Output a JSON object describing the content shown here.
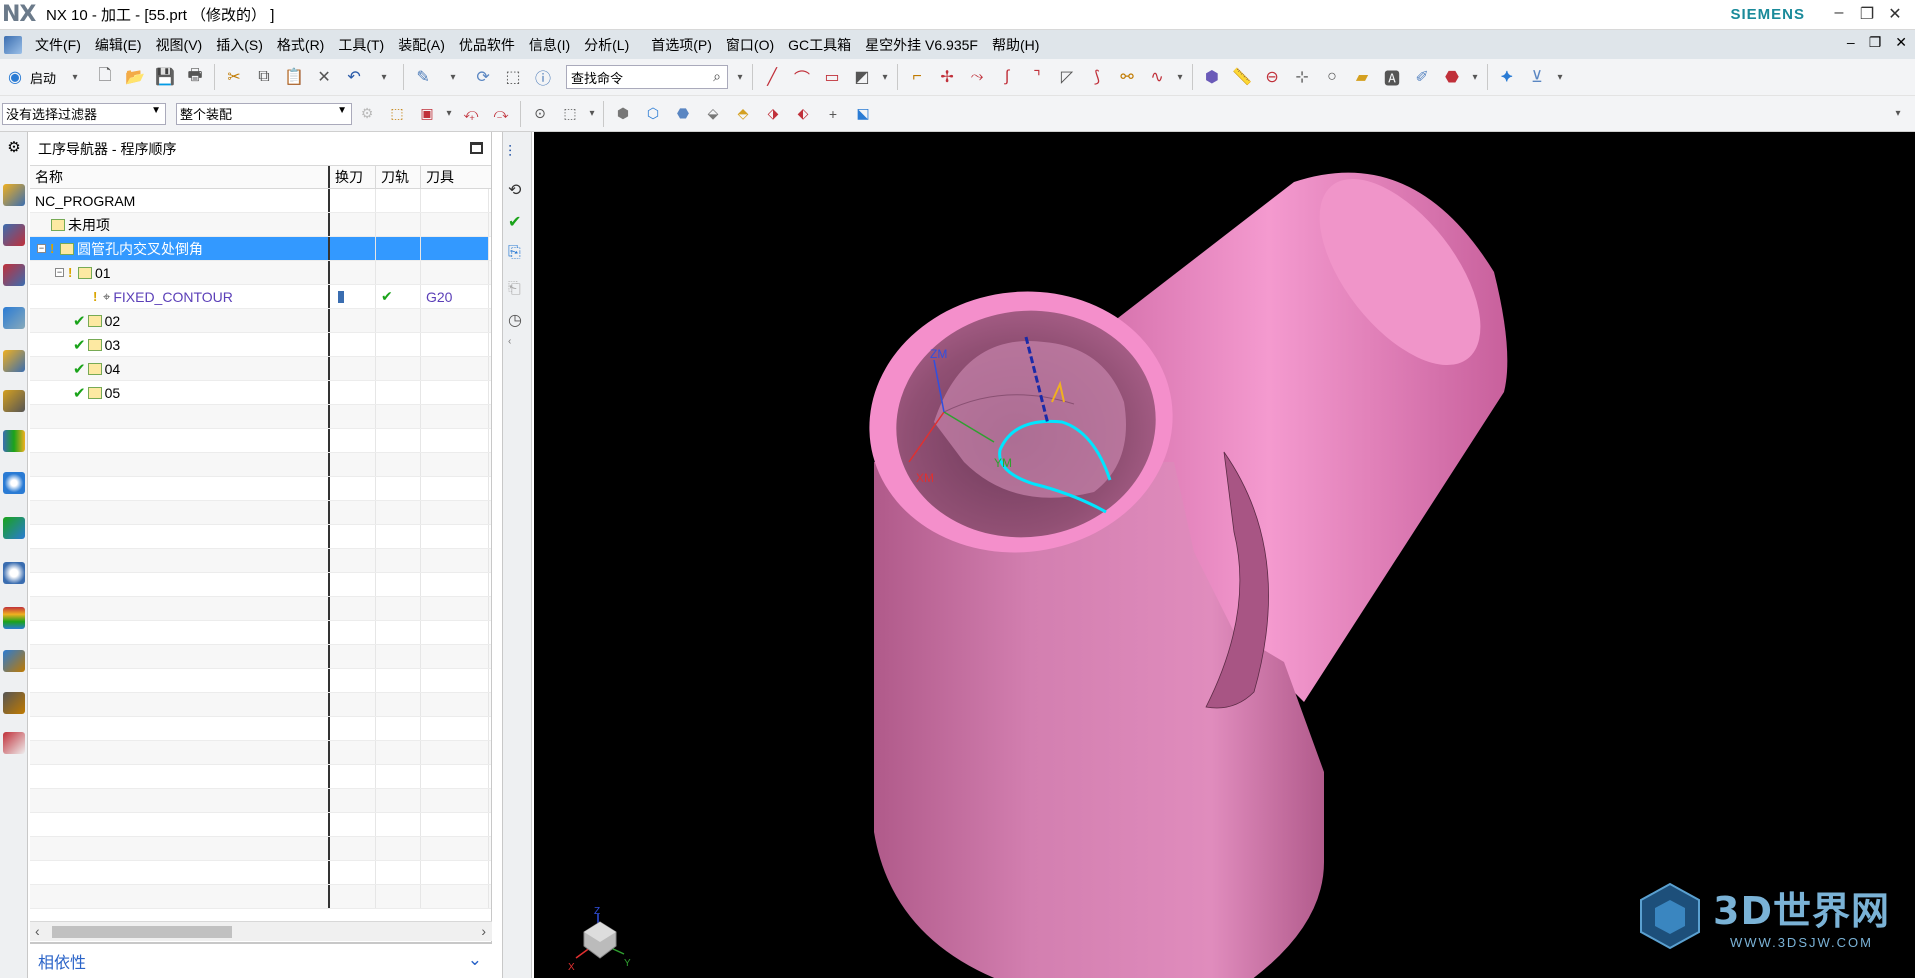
{
  "title": {
    "logo": "NX",
    "text": "NX 10 - 加工 - [55.prt （修改的） ]",
    "brand": "SIEMENS"
  },
  "menu": {
    "items": [
      "文件(F)",
      "编辑(E)",
      "视图(V)",
      "插入(S)",
      "格式(R)",
      "工具(T)",
      "装配(A)",
      "优品软件",
      "信息(I)",
      "分析(L)",
      "首选项(P)",
      "窗口(O)",
      "GC工具箱",
      "星空外挂 V6.935F",
      "帮助(H)"
    ]
  },
  "toolbar": {
    "start_label": "启动",
    "search_placeholder": "查找命令",
    "filter_value": "没有选择过滤器",
    "assembly_value": "整个装配"
  },
  "navigator": {
    "title": "工序导航器 - 程序顺序",
    "columns": {
      "name": "名称",
      "tool_change": "换刀",
      "tool_path": "刀轨",
      "tool": "刀具"
    },
    "rows": [
      {
        "name": "NC_PROGRAM",
        "tool_change": "",
        "tool_path": "",
        "tool": ""
      },
      {
        "name": "未用项",
        "tool_change": "",
        "tool_path": "",
        "tool": ""
      },
      {
        "name": "圆管孔内交叉处倒角",
        "tool_change": "",
        "tool_path": "",
        "tool": ""
      },
      {
        "name": "01",
        "tool_change": "",
        "tool_path": "",
        "tool": ""
      },
      {
        "name": "FIXED_CONTOUR",
        "tool_change": "",
        "tool_path": "✔",
        "tool": "G20"
      },
      {
        "name": "02",
        "tool_change": "",
        "tool_path": "",
        "tool": ""
      },
      {
        "name": "03",
        "tool_change": "",
        "tool_path": "",
        "tool": ""
      },
      {
        "name": "04",
        "tool_change": "",
        "tool_path": "",
        "tool": ""
      },
      {
        "name": "05",
        "tool_change": "",
        "tool_path": "",
        "tool": ""
      }
    ],
    "dependency_label": "相依性"
  },
  "viewport": {
    "axis_labels": {
      "zm": "ZM",
      "xm": "XM",
      "ym": "YM"
    },
    "triad_labels": {
      "z": "Z",
      "x": "X",
      "y": "Y"
    },
    "watermark_text": "3D世界网",
    "watermark_url": "WWW.3DSJW.COM"
  },
  "colors": {
    "pipe": "#ef8ac5",
    "selection": "#3399ff",
    "toolpath": "#00e5ff",
    "menubar": "#dfe5ea"
  }
}
